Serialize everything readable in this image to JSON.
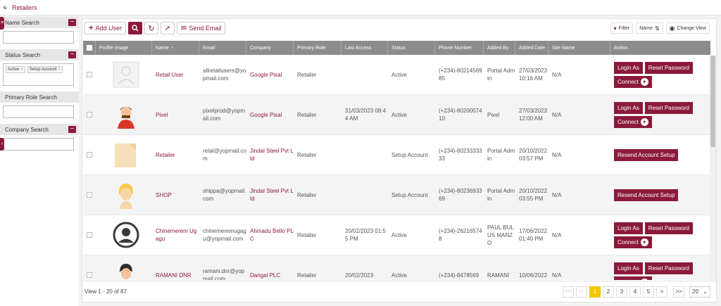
{
  "breadcrumb": {
    "label": "Retailers"
  },
  "sidebar": {
    "filters": [
      {
        "label": "Name Search"
      },
      {
        "label": "Status Search",
        "tags": [
          "Active",
          "Setup Account"
        ]
      },
      {
        "label": "Primary Role Search"
      },
      {
        "label": "Company Search"
      }
    ]
  },
  "toolbar": {
    "add_user": "Add User",
    "send_email": "Send Email"
  },
  "right_tools": {
    "filter": "Filter",
    "name_sort": "Name",
    "change_view": "Change View"
  },
  "table": {
    "headers": [
      "Profile Image",
      "Name",
      "Email",
      "Company",
      "Primary Role",
      "Last Access",
      "Status",
      "Phone Number",
      "Added By",
      "Added Date",
      "Site Name",
      "Action"
    ],
    "rows": [
      {
        "name": "Retail User",
        "email": "allretailusers@yopmail.com",
        "company": "Google Pixal",
        "role": "Retailer",
        "last_access": "",
        "status": "Active",
        "phone": "(+234)-8021456985",
        "added_by": "Portal Admin",
        "added_date": "27/03/2023 10:16 AM",
        "site": "N/A",
        "avatar": "placeholder",
        "actions": "full"
      },
      {
        "name": "Pixel",
        "email": "pixelprod@yopmail.com",
        "company": "Google Pixal",
        "role": "Retailer",
        "last_access": "31/03/2023 08:44 AM",
        "status": "Active",
        "phone": "(+234)-8020007410",
        "added_by": "Pixel",
        "added_date": "27/03/2023 12:00 AM",
        "site": "N/A",
        "avatar": "man-red",
        "actions": "full"
      },
      {
        "name": "Retailer",
        "email": "retal@yopmail.com",
        "company": "Jindal Steel Pvt Ltd",
        "role": "Retailer",
        "last_access": "",
        "status": "Setup Account",
        "phone": "(+234)-8023333333",
        "added_by": "Portal Admin",
        "added_date": "20/10/2022 03:57 PM",
        "site": "N/A",
        "avatar": "paper",
        "actions": "resend"
      },
      {
        "name": "SHOP",
        "email": "shippa@yopmail.com",
        "company": "Jindal Steel Pvt Ltd",
        "role": "Retailer",
        "last_access": "",
        "status": "Setup Account",
        "phone": "(+234)-8023693369",
        "added_by": "Portal Admin",
        "added_date": "20/10/2022 03:55 PM",
        "site": "N/A",
        "avatar": "blonde",
        "actions": "resend"
      },
      {
        "name": "Chinemerem Ugagu",
        "email": "chinemeremugagu@yopmail.com",
        "company": "Ahmadu Bello PLC",
        "role": "Retailer",
        "last_access": "20/02/2023 01:55 PM",
        "status": "Active",
        "phone": "(+234)-262165748",
        "added_by": "PAUL BULUS MANZO",
        "added_date": "17/06/2022 01:40 PM",
        "site": "N/A",
        "avatar": "circle-user",
        "actions": "full"
      },
      {
        "name": "RAMANI DNR",
        "email": "ramani.dnr@yopmail.com",
        "company": "Dangal PLC",
        "role": "Retailer",
        "last_access": "20/02/2023",
        "status": "Active",
        "phone": "(+234)-8478569",
        "added_by": "RAMANI",
        "added_date": "10/06/2022",
        "site": "N/A",
        "avatar": "dark-hair",
        "actions": "full"
      }
    ],
    "action_labels": {
      "login_as": "Login As",
      "reset_password": "Reset Password",
      "connect": "Connect",
      "resend": "Resend Account Setup"
    }
  },
  "footer": {
    "view_info": "View 1 - 20 of 87",
    "pages": [
      "1",
      "2",
      "3",
      "4",
      "5"
    ],
    "page_size": "20",
    "first": "<<",
    "prev": "<",
    "next": ">",
    "last": ">>"
  }
}
